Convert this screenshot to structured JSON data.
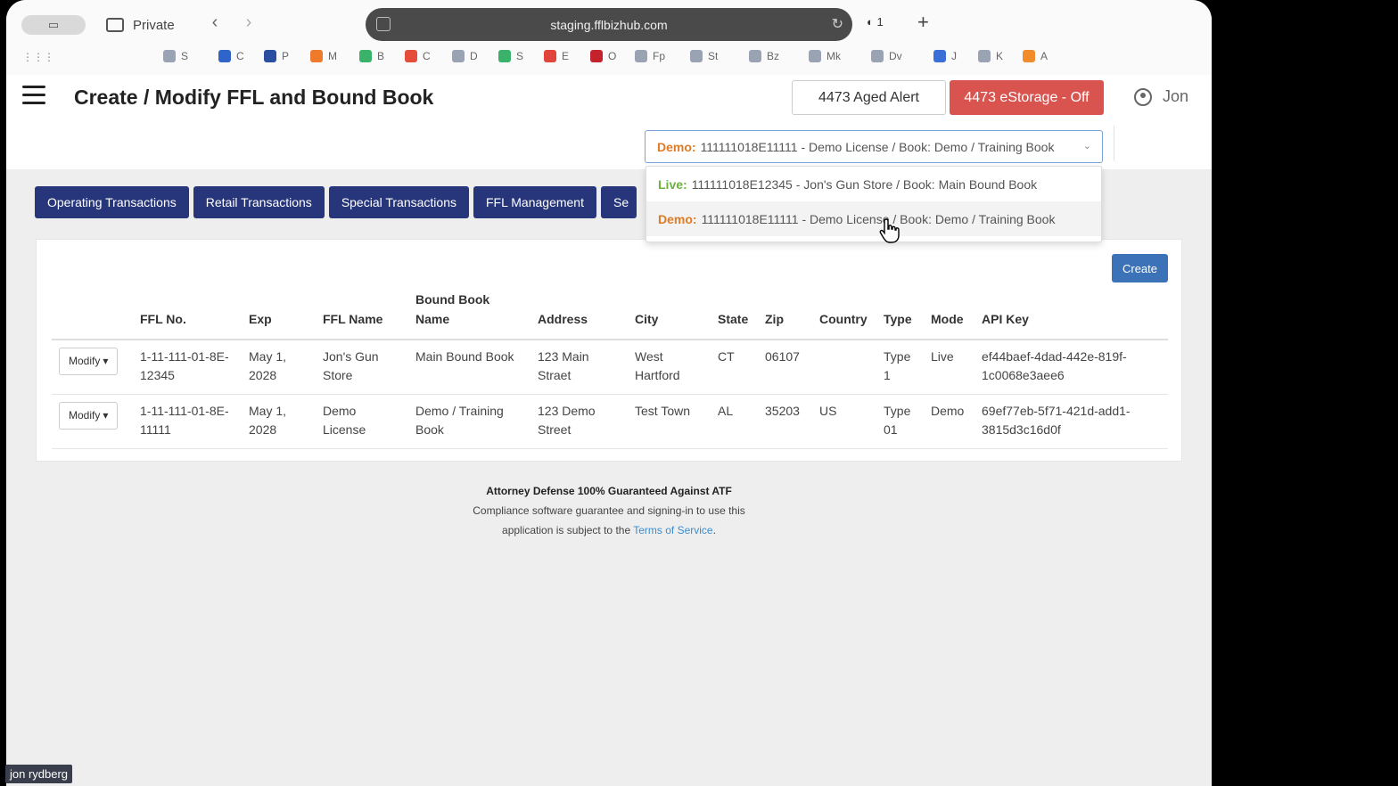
{
  "browser": {
    "private_label": "Private",
    "url": "staging.fflbizhub.com",
    "shield_count": "1",
    "bookmarks": [
      {
        "label": "S",
        "color": "#9aa3b3"
      },
      {
        "label": "C",
        "color": "#2f64c8"
      },
      {
        "label": "P",
        "color": "#2a4fa0"
      },
      {
        "label": "M",
        "color": "#f07a2b"
      },
      {
        "label": "B",
        "color": "#3ab26a"
      },
      {
        "label": "C",
        "color": "#e44d3a"
      },
      {
        "label": "D",
        "color": "#9aa3b3"
      },
      {
        "label": "S",
        "color": "#3ab26a"
      },
      {
        "label": "E",
        "color": "#e0443a"
      },
      {
        "label": "O",
        "color": "#c4232e"
      },
      {
        "label": "Fp",
        "color": "#9aa3b3"
      },
      {
        "label": "St",
        "color": "#9aa3b3"
      },
      {
        "label": "Bz",
        "color": "#9aa3b3"
      },
      {
        "label": "Mk",
        "color": "#9aa3b3"
      },
      {
        "label": "Dv",
        "color": "#9aa3b3"
      },
      {
        "label": "J",
        "color": "#3a6fd8"
      },
      {
        "label": "K",
        "color": "#9aa3b3"
      },
      {
        "label": "A",
        "color": "#f08c2b"
      }
    ]
  },
  "header": {
    "title": "Create / Modify FFL and Bound Book",
    "aged_alert": "4473 Aged Alert",
    "estorage": "4473 eStorage - Off",
    "user_name": "Jon"
  },
  "book_select": {
    "selected_tag": "Demo:",
    "selected_value": "111111018E11111 - Demo License / Book: Demo / Training Book",
    "options": [
      {
        "tag": "Live:",
        "value": "111111018E12345 - Jon's Gun Store / Book: Main Bound Book"
      },
      {
        "tag": "Demo:",
        "value": "111111018E11111 - Demo License / Book: Demo / Training Book"
      }
    ]
  },
  "tabs": [
    "Operating Transactions",
    "Retail Transactions",
    "Special Transactions",
    "FFL Management",
    "Se"
  ],
  "table": {
    "create_label": "Create",
    "modify_label": "Modify",
    "columns": [
      "FFL No.",
      "Exp",
      "FFL Name",
      "Bound Book Name",
      "Address",
      "City",
      "State",
      "Zip",
      "Country",
      "Type",
      "Mode",
      "API Key"
    ],
    "rows": [
      [
        "1-11-111-01-8E-12345",
        "May 1, 2028",
        "Jon's Gun Store",
        "Main Bound Book",
        "123 Main Straet",
        "West Hartford",
        "CT",
        "06107",
        "",
        "Type 1",
        "Live",
        "ef44baef-4dad-442e-819f-1c0068e3aee6"
      ],
      [
        "1-11-111-01-8E-11111",
        "May 1, 2028",
        "Demo License",
        "Demo / Training Book",
        "123 Demo Street",
        "Test Town",
        "AL",
        "35203",
        "US",
        "Type 01",
        "Demo",
        "69ef77eb-5f71-421d-add1-3815d3c16d0f"
      ]
    ]
  },
  "footer": {
    "title": "Attorney Defense 100% Guaranteed Against ATF",
    "line1": "Compliance software guarantee and signing-in to use this",
    "line2": "application is subject to the",
    "link": "Terms of Service",
    "period": "."
  },
  "overlay_name": "jon rydberg"
}
